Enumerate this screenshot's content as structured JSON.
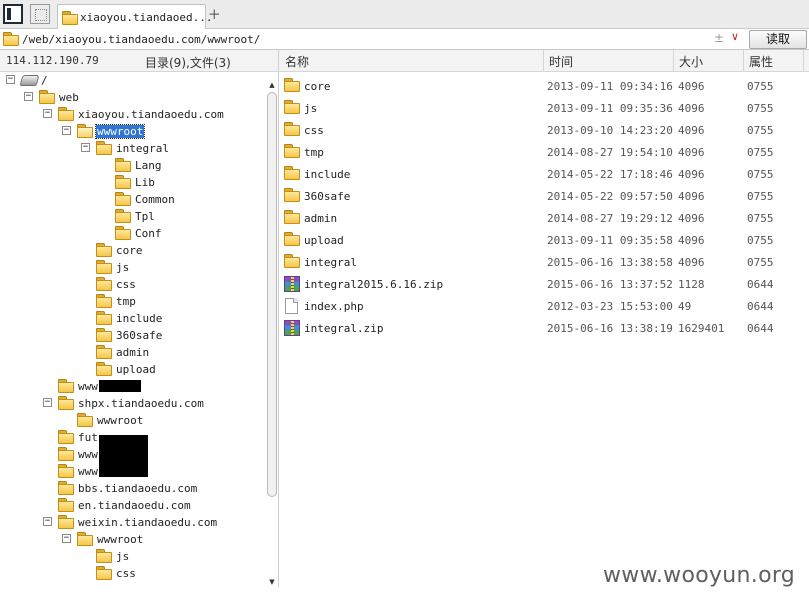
{
  "tab": {
    "label": "xiaoyou.tiandaoed...",
    "add_label": "+"
  },
  "address": {
    "path": "/web/xiaoyou.tiandaoedu.com/wwwroot/",
    "plusminus": "±",
    "dropdown": "∨",
    "read_button": "读取"
  },
  "left_header": {
    "ip": "114.112.190.79",
    "summary": "目录(9),文件(3)"
  },
  "columns": {
    "name": "名称",
    "time": "时间",
    "size": "大小",
    "attr": "属性"
  },
  "tree": [
    {
      "id": "root",
      "label": "/",
      "toggle": "−",
      "icon": "drive"
    },
    {
      "id": "web",
      "label": "web",
      "toggle": "−",
      "icon": "folder"
    },
    {
      "id": "xiaoyou",
      "label": "xiaoyou.tiandaoedu.com",
      "toggle": "−",
      "icon": "folder"
    },
    {
      "id": "wwwroot",
      "label": "wwwroot",
      "toggle": "−",
      "icon": "folder-open",
      "selected": true
    },
    {
      "id": "integral",
      "label": "integral",
      "toggle": "−",
      "icon": "folder"
    },
    {
      "id": "lang",
      "label": "Lang",
      "icon": "folder"
    },
    {
      "id": "lib",
      "label": "Lib",
      "icon": "folder"
    },
    {
      "id": "common",
      "label": "Common",
      "icon": "folder"
    },
    {
      "id": "tpl",
      "label": "Tpl",
      "icon": "folder"
    },
    {
      "id": "conf",
      "label": "Conf",
      "icon": "folder"
    },
    {
      "id": "core",
      "label": "core",
      "icon": "folder"
    },
    {
      "id": "js",
      "label": "js",
      "icon": "folder"
    },
    {
      "id": "css",
      "label": "css",
      "icon": "folder"
    },
    {
      "id": "tmp",
      "label": "tmp",
      "icon": "folder"
    },
    {
      "id": "include",
      "label": "include",
      "icon": "folder"
    },
    {
      "id": "360safe",
      "label": "360safe",
      "icon": "folder"
    },
    {
      "id": "admin",
      "label": "admin",
      "icon": "folder"
    },
    {
      "id": "upload",
      "label": "upload",
      "icon": "folder"
    },
    {
      "id": "www-redacted",
      "label": "www          com",
      "icon": "folder"
    },
    {
      "id": "shpx",
      "label": "shpx.tiandaoedu.com",
      "toggle": "−",
      "icon": "folder"
    },
    {
      "id": "shpx-wwwroot",
      "label": "wwwroot",
      "icon": "folder"
    },
    {
      "id": "fut",
      "label": "fut          .cn",
      "icon": "folder"
    },
    {
      "id": "www-cn-1",
      "label": "www          .cn",
      "icon": "folder"
    },
    {
      "id": "www-cn-2",
      "label": "www          .cn",
      "icon": "folder"
    },
    {
      "id": "bbs",
      "label": "bbs.tiandaoedu.com",
      "icon": "folder"
    },
    {
      "id": "en",
      "label": "en.tiandaoedu.com",
      "icon": "folder"
    },
    {
      "id": "weixin",
      "label": "weixin.tiandaoedu.com",
      "toggle": "−",
      "icon": "folder"
    },
    {
      "id": "weixin-wwwroot",
      "label": "wwwroot",
      "toggle": "−",
      "icon": "folder"
    },
    {
      "id": "weixin-js",
      "label": "js",
      "icon": "folder"
    },
    {
      "id": "weixin-css",
      "label": "css",
      "icon": "folder"
    }
  ],
  "files": [
    {
      "name": "core",
      "time": "2013-09-11 09:34:16",
      "size": "4096",
      "attr": "0755",
      "icon": "folder"
    },
    {
      "name": "js",
      "time": "2013-09-11 09:35:36",
      "size": "4096",
      "attr": "0755",
      "icon": "folder"
    },
    {
      "name": "css",
      "time": "2013-09-10 14:23:20",
      "size": "4096",
      "attr": "0755",
      "icon": "folder"
    },
    {
      "name": "tmp",
      "time": "2014-08-27 19:54:10",
      "size": "4096",
      "attr": "0755",
      "icon": "folder"
    },
    {
      "name": "include",
      "time": "2014-05-22 17:18:46",
      "size": "4096",
      "attr": "0755",
      "icon": "folder"
    },
    {
      "name": "360safe",
      "time": "2014-05-22 09:57:50",
      "size": "4096",
      "attr": "0755",
      "icon": "folder"
    },
    {
      "name": "admin",
      "time": "2014-08-27 19:29:12",
      "size": "4096",
      "attr": "0755",
      "icon": "folder"
    },
    {
      "name": "upload",
      "time": "2013-09-11 09:35:58",
      "size": "4096",
      "attr": "0755",
      "icon": "folder"
    },
    {
      "name": "integral",
      "time": "2015-06-16 13:38:58",
      "size": "4096",
      "attr": "0755",
      "icon": "folder"
    },
    {
      "name": "integral2015.6.16.zip",
      "time": "2015-06-16 13:37:52",
      "size": "1128",
      "attr": "0644",
      "icon": "zip"
    },
    {
      "name": "index.php",
      "time": "2012-03-23 15:53:00",
      "size": "49",
      "attr": "0644",
      "icon": "file"
    },
    {
      "name": "integral.zip",
      "time": "2015-06-16 13:38:19",
      "size": "1629401",
      "attr": "0644",
      "icon": "zip"
    }
  ],
  "watermark": "www.wooyun.org"
}
